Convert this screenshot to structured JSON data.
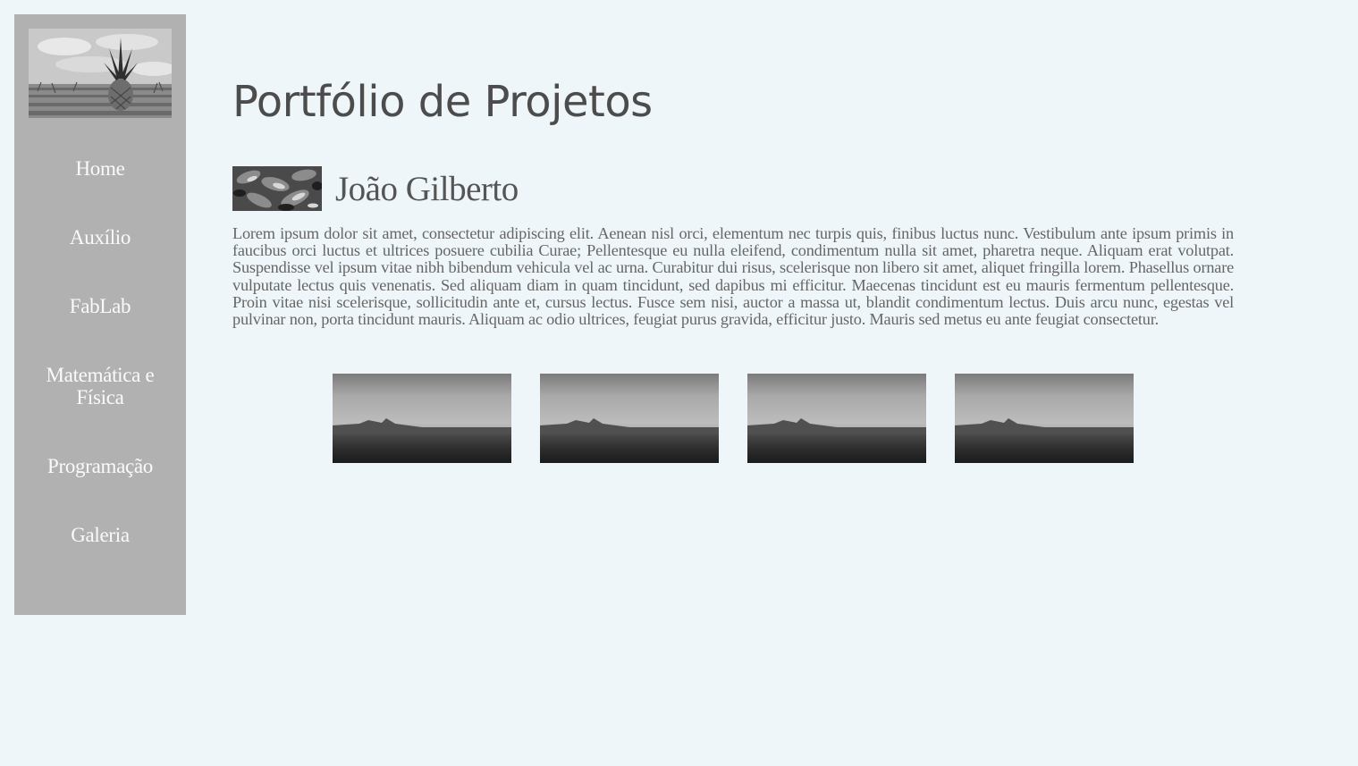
{
  "sidebar": {
    "logo_icon": "pineapple-field-photo",
    "items": [
      {
        "label": "Home"
      },
      {
        "label": "Auxílio"
      },
      {
        "label": "FabLab"
      },
      {
        "label": "Matemática e Física"
      },
      {
        "label": "Programação"
      },
      {
        "label": "Galeria"
      }
    ]
  },
  "main": {
    "title": "Portfólio de Projetos",
    "author": {
      "avatar_icon": "leaves-photo",
      "name": "João Gilberto"
    },
    "description": "Lorem ipsum dolor sit amet, consectetur adipiscing elit. Aenean nisl orci, elementum nec turpis quis, finibus luctus nunc. Vestibulum ante ipsum primis in faucibus orci luctus et ultrices posuere cubilia Curae; Pellentesque eu nulla eleifend, condimentum nulla sit amet, pharetra neque. Aliquam erat volutpat. Suspendisse vel ipsum vitae nibh bibendum vehicula vel ac urna. Curabitur dui risus, scelerisque non libero sit amet, aliquet fringilla lorem. Phasellus ornare vulputate lectus quis venenatis. Sed aliquam diam in quam tincidunt, sed dapibus mi efficitur. Maecenas tincidunt est eu mauris fermentum pellentesque. Proin vitae nisi scelerisque, sollicitudin ante et, cursus lectus. Fusce sem nisi, auctor a massa ut, blandit condimentum lectus. Duis arcu nunc, egestas vel pulvinar non, porta tincidunt mauris. Aliquam ac odio ultrices, feugiat purus gravida, efficitur justo. Mauris sed metus eu ante feugiat consectetur.",
    "gallery": [
      {
        "icon": "foggy-landscape-photo"
      },
      {
        "icon": "foggy-landscape-photo"
      },
      {
        "icon": "foggy-landscape-photo"
      },
      {
        "icon": "foggy-landscape-photo"
      }
    ]
  },
  "colors": {
    "page_background": "#eef6f9",
    "sidebar_background": "#b1b1b1",
    "nav_text": "#fafafa",
    "title_text": "#4c4c4c",
    "body_text": "#666666"
  }
}
